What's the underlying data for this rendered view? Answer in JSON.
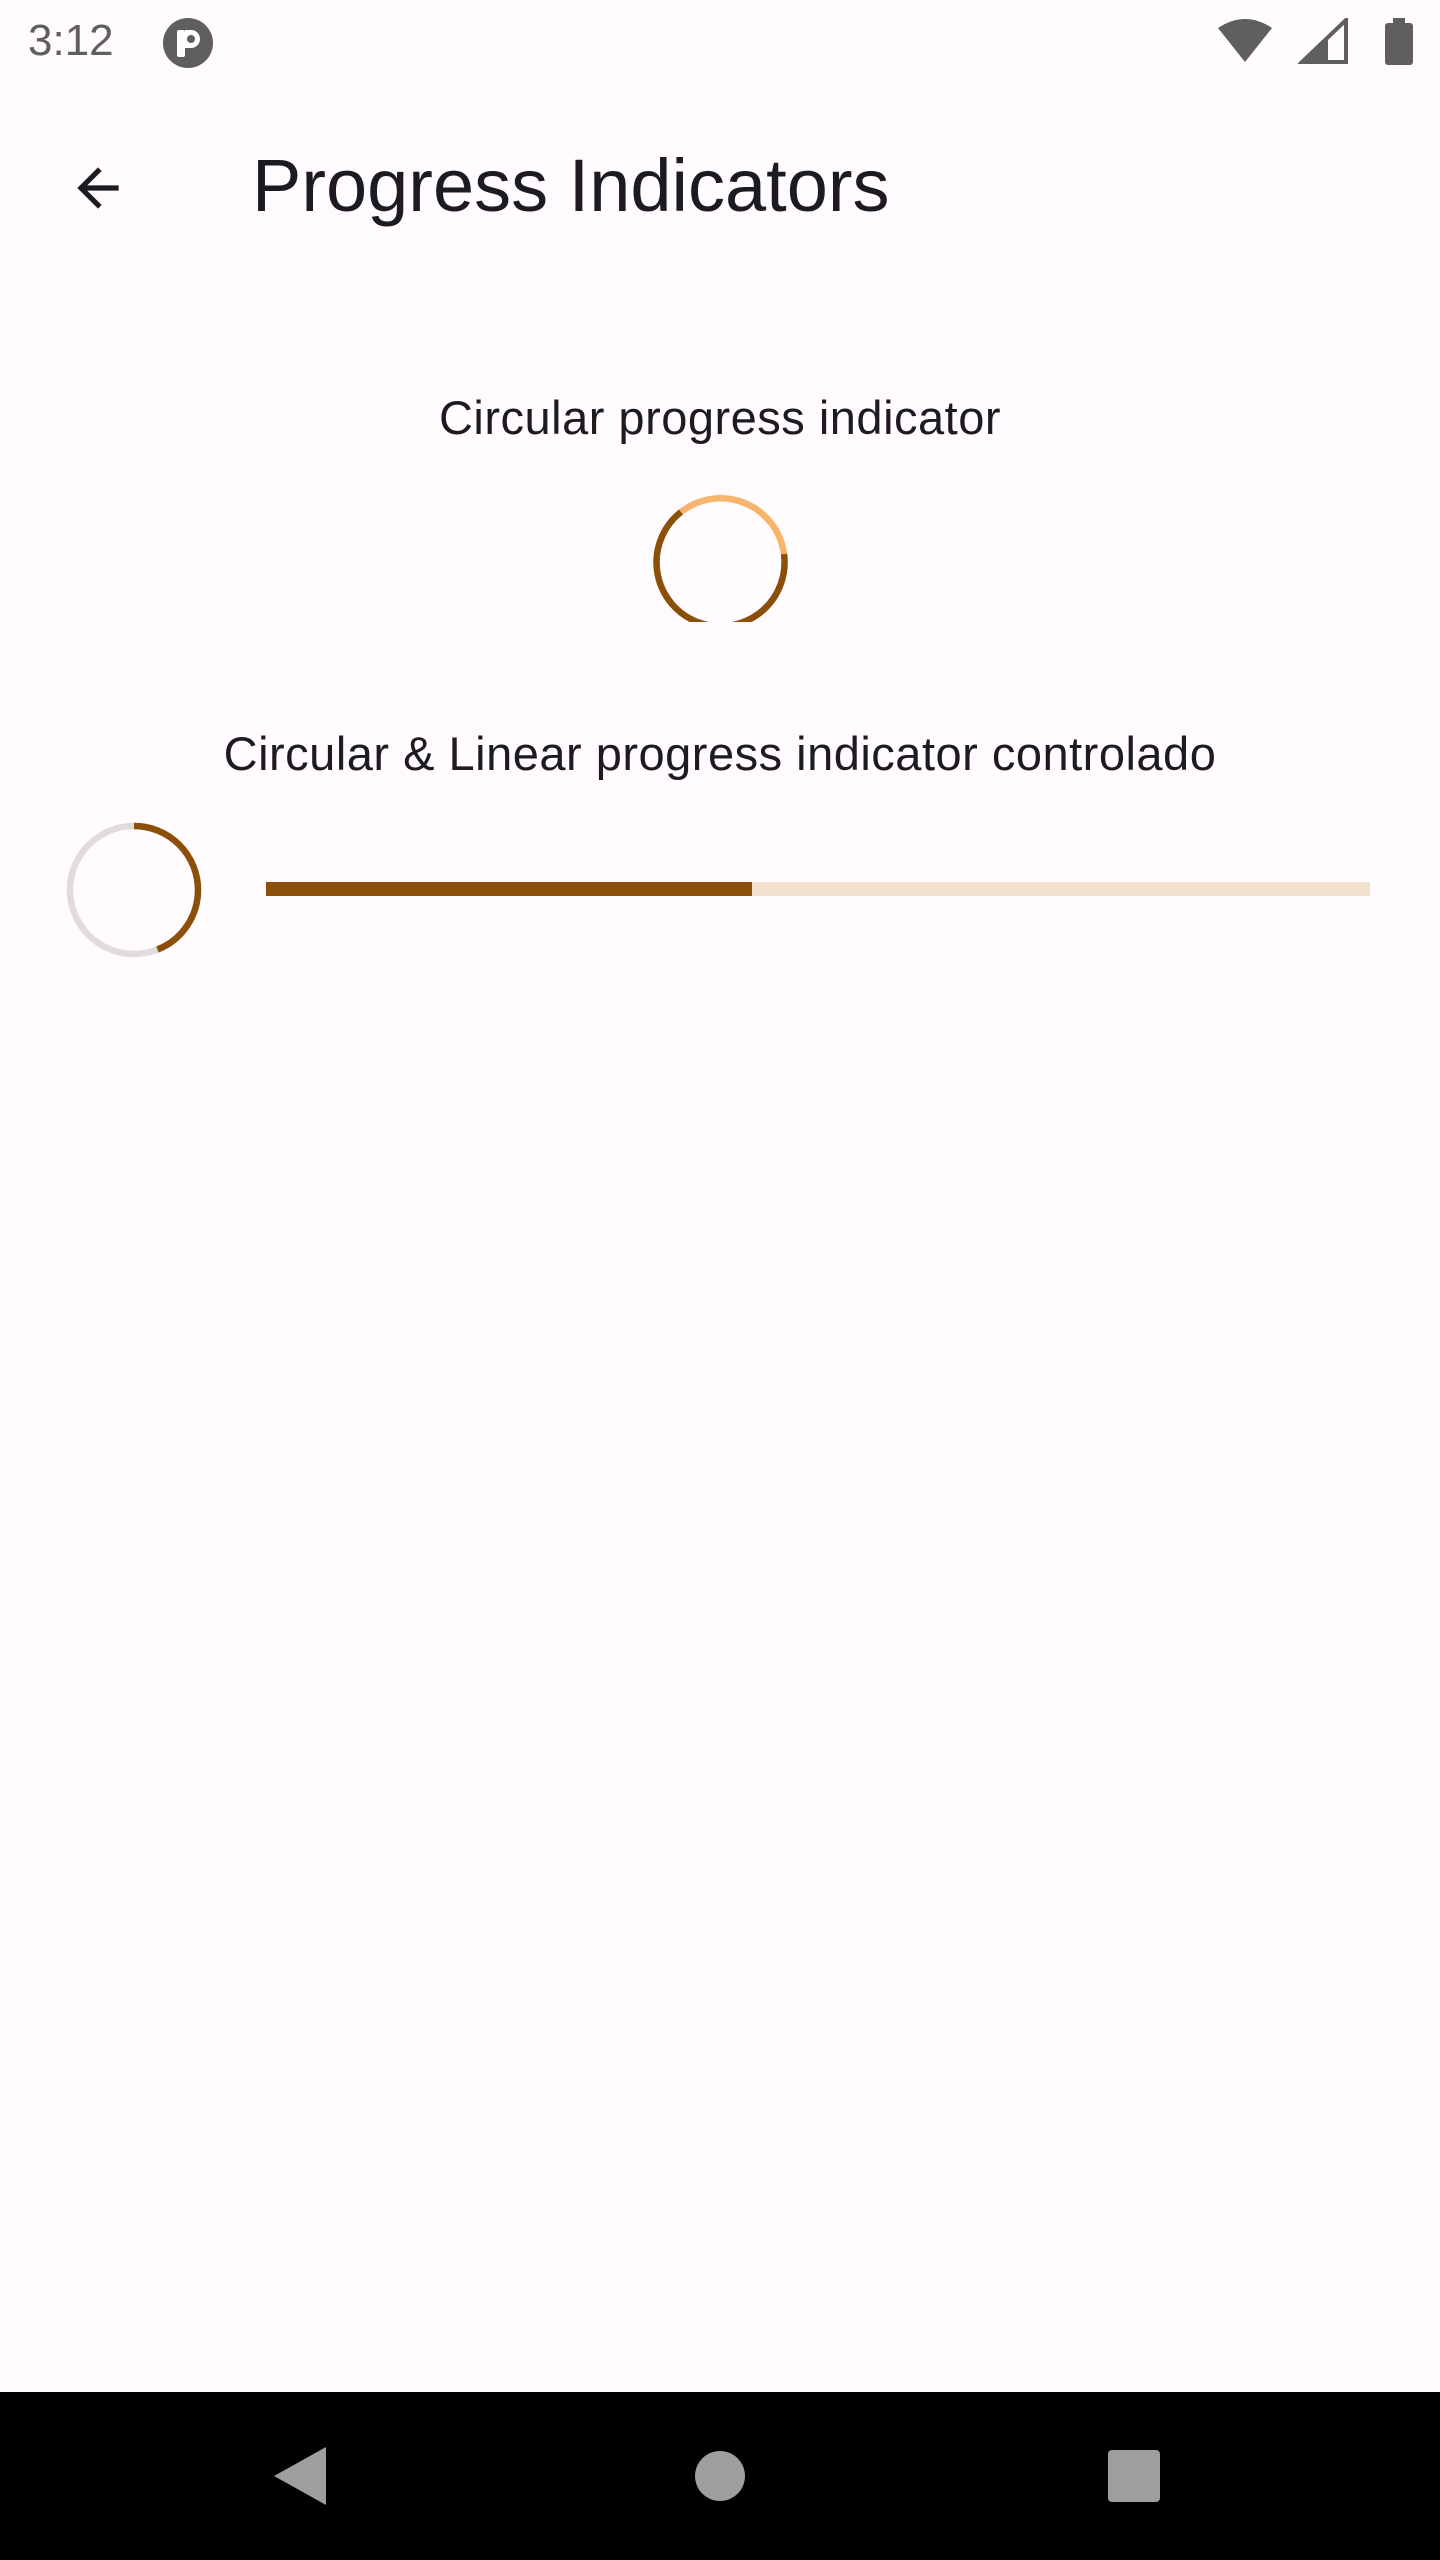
{
  "status_bar": {
    "time": "3:12",
    "icons": [
      "notification-app-icon",
      "wifi-icon",
      "signal-icon",
      "battery-icon"
    ]
  },
  "app_bar": {
    "back_icon": "arrow-back-icon",
    "title": "Progress Indicators"
  },
  "sections": [
    {
      "label": "Circular progress indicator",
      "indicator": "indeterminate-circular"
    },
    {
      "label": "Circular & Linear progress indicator controlado",
      "circular_progress": 0.44,
      "linear_progress": 0.44
    }
  ],
  "colors": {
    "background": "#fffbfe",
    "primary": "#8a4f08",
    "primary_light": "#f7b56b",
    "track_circular": "#e0dcde",
    "track_linear": "#f2e0cd",
    "nav_bar": "#000000",
    "nav_icon": "#9e9e9e"
  },
  "navigation_bar": {
    "buttons": [
      "nav-back-icon",
      "nav-home-icon",
      "nav-recents-icon"
    ]
  }
}
